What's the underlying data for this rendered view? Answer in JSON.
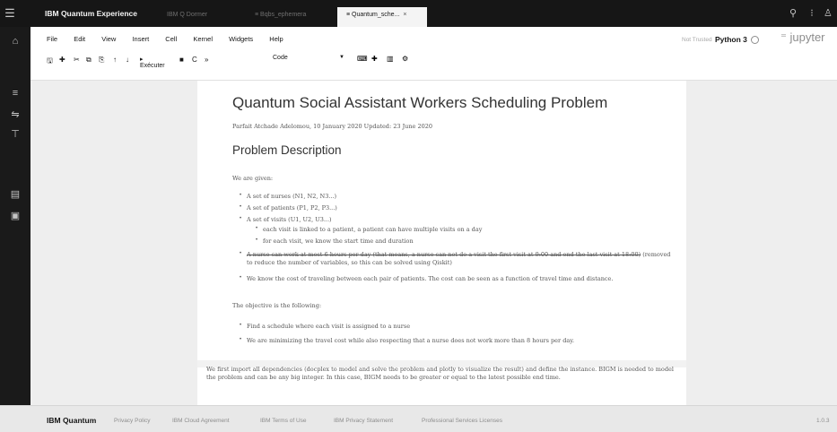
{
  "topbar": {
    "brand": "IBM Quantum Experience",
    "tabs": [
      {
        "label": "IBM Q Dormer",
        "active": false
      },
      {
        "label": "Bqbs_ephemera",
        "active": false
      },
      {
        "label": "Quantum_sche...",
        "active": true,
        "close": "×"
      }
    ],
    "search_icon": "search-icon",
    "help_icon": "help-icon",
    "user_icon": "user-icon"
  },
  "leftnav": {
    "items": [
      "home-icon",
      "menu-icon",
      "circuit-icon",
      "notebook-icon",
      "results-icon",
      "docs-icon"
    ]
  },
  "jupyter": {
    "menu": [
      "File",
      "Edit",
      "View",
      "Insert",
      "Cell",
      "Kernel",
      "Widgets",
      "Help"
    ],
    "toolbar": {
      "executer_label": "▸ Exécuter",
      "celltype": "Code"
    },
    "trusted": "Not Trusted",
    "kernel": "Python 3",
    "logo": "jupyter"
  },
  "notebook": {
    "title": "Quantum Social Assistant Workers Scheduling Problem",
    "author_line": "Parfait Atchade Adelomou, 10 January 2020 Updated: 23 June 2020",
    "section": "Problem Description",
    "given_label": "We are given:",
    "given_items": [
      "A set of nurses (N1, N2, N3...)",
      "A set of patients (P1, P2, P3...)",
      "A set of visits (U1, U2, U3...)"
    ],
    "visit_subitems": [
      "each visit is linked to a patient, a patient can have multiple visits on a day",
      "for each visit, we know the start time and duration"
    ],
    "struck_text": "A nurse can work at most 6 hours per day (that means, a nurse can not do a visit the first visit at 9:00 and end the last visit at 18:00)",
    "struck_note": " (removed to reduce the number of variables, so this can be solved using Qiskit)",
    "cost_item": "We know the cost of traveling between each pair of patients. The cost can be seen as a function of travel time and distance.",
    "objective_label": "The objective is the following:",
    "objective_items": [
      "Find a schedule where each visit is assigned to a nurse",
      "We are minimizing the travel cost while also respecting that a nurse does not work more than 8 hours per day."
    ],
    "cell2_text": "We first import all dependencies (docplex to model and solve the problem and plotly to visualize the result) and define the instance. BIGM is needed to model the problem and can be any big integer. In this case, BIGM needs to be greater or equal to the latest possible end time."
  },
  "footer": {
    "brand": "IBM Quantum",
    "links": [
      "Privacy Policy",
      "IBM Cloud Agreement",
      "IBM Terms of Use",
      "IBM Privacy Statement",
      "Professional Services Licenses"
    ],
    "version": "1.0.3"
  }
}
